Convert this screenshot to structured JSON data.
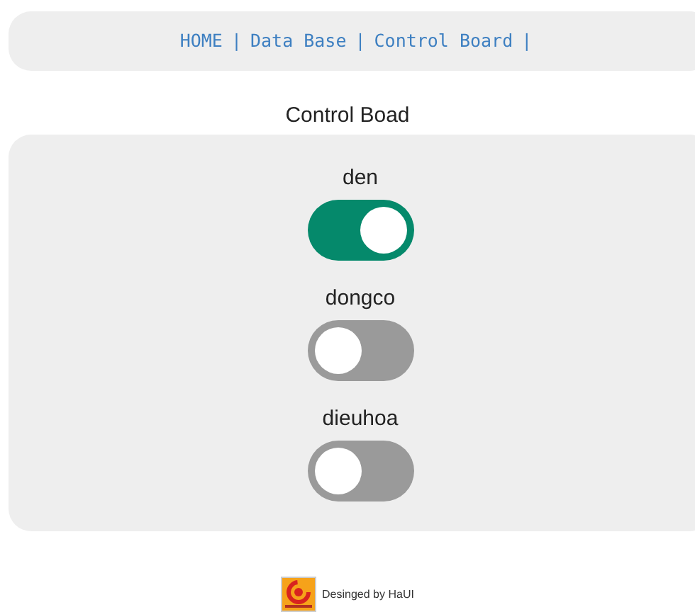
{
  "nav": [
    {
      "label": "HOME",
      "separator": "|"
    },
    {
      "label": "Data Base",
      "separator": "|"
    },
    {
      "label": "Control Board",
      "separator": "|"
    }
  ],
  "title": "Control Boad",
  "switches": [
    {
      "label": "den",
      "on": true
    },
    {
      "label": "dongco",
      "on": false
    },
    {
      "label": "dieuhoa",
      "on": false
    }
  ],
  "footer": {
    "text": "Desinged by HaUI"
  }
}
